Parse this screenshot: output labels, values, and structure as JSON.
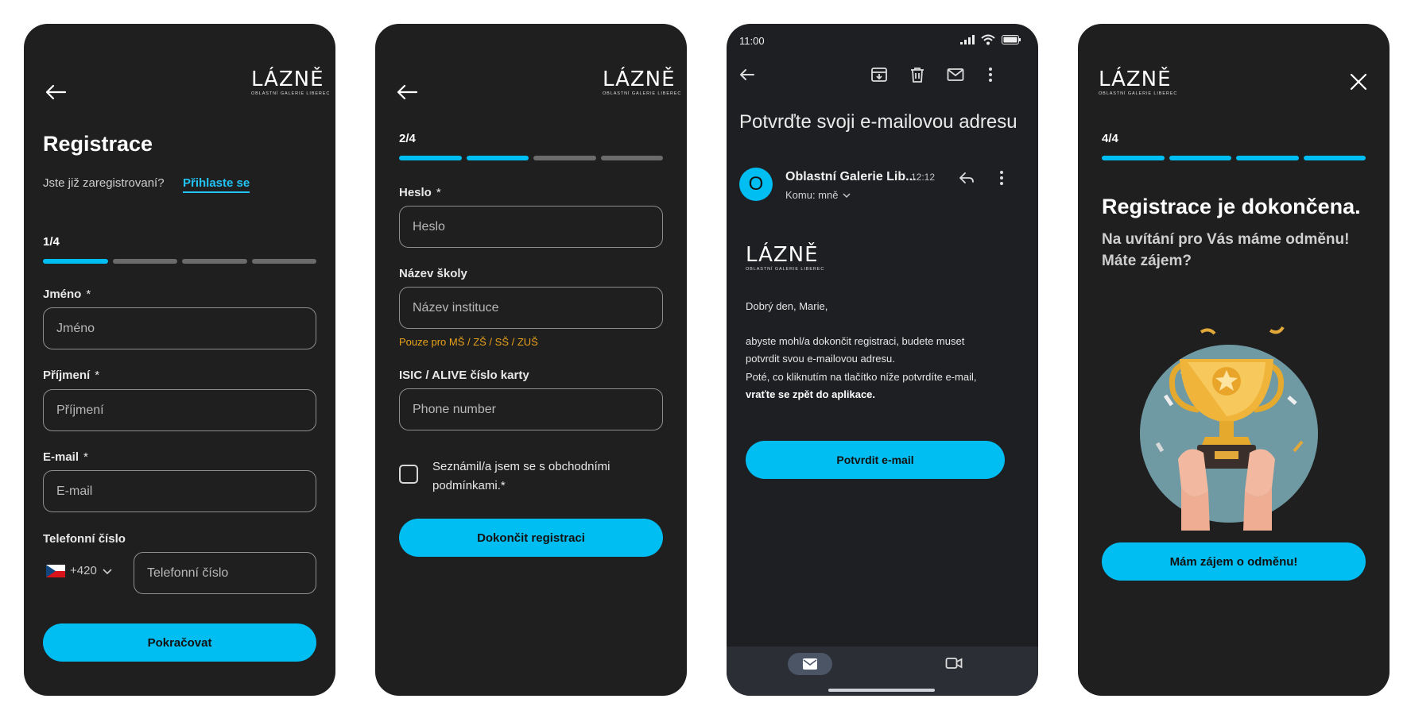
{
  "brand": {
    "logo_main": "LÁZNĚ",
    "logo_sub": "OBLASTNÍ GALERIE LIBEREC"
  },
  "screen1": {
    "title": "Registrace",
    "already_registered": "Jste již zaregistrovaní?",
    "login_link": "Přihlaste se",
    "step": "1/4",
    "progress": {
      "current": 1,
      "total": 4
    },
    "fields": [
      {
        "label": "Jméno",
        "required_mark": "*",
        "placeholder": "Jméno"
      },
      {
        "label": "Příjmení",
        "required_mark": "*",
        "placeholder": "Příjmení"
      },
      {
        "label": "E-mail",
        "required_mark": "*",
        "placeholder": "E-mail"
      }
    ],
    "phone_label": "Telefonní číslo",
    "country_code": "+420",
    "phone_placeholder": "Telefonní číslo",
    "continue_button": "Pokračovat"
  },
  "screen2": {
    "step": "2/4",
    "progress": {
      "current": 2,
      "total": 4
    },
    "password_label": "Heslo",
    "password_required": "*",
    "password_placeholder": "Heslo",
    "school_label": "Název školy",
    "school_placeholder": "Název instituce",
    "school_hint": "Pouze pro MŠ / ZŠ / SŠ / ZUŠ",
    "card_label": "ISIC / ALIVE číslo karty",
    "card_placeholder": "Phone number",
    "terms_text": "Seznámil/a jsem se s obchodními podmínkami.*",
    "terms_checked": false,
    "finish_button": "Dokončit registraci"
  },
  "screen3": {
    "status_time": "11:00",
    "subject": "Potvrďte svoji e-mailovou adresu",
    "avatar_letter": "O",
    "sender": "Oblastní Galerie Lib...",
    "time": "12:12",
    "to": "Komu: mně",
    "greeting": "Dobrý den, Marie,",
    "para1": "abyste mohl/a dokončit registraci, budete muset potvrdit svou e-mailovou adresu.",
    "para2": "Poté, co kliknutím na tlačítko níže potvrdíte e-mail,",
    "para2_bold": "vraťte se zpět do aplikace.",
    "confirm_button": "Potvrdit e-mail",
    "icons": [
      "back-arrow-icon",
      "archive-icon",
      "trash-icon",
      "mail-icon",
      "more-vert-icon",
      "reply-icon",
      "video-icon"
    ]
  },
  "screen4": {
    "step": "4/4",
    "progress": {
      "current": 4,
      "total": 4
    },
    "title": "Registrace je dokončena.",
    "subtitle": "Na uvítání pro Vás máme odměnu! Máte zájem?",
    "reward_button": "Mám zájem o odměnu!"
  },
  "colors": {
    "accent": "#00bdf2",
    "background": "#1f1f1f",
    "hint": "#e8a21a",
    "inactive_progress": "#6b6b6b"
  }
}
